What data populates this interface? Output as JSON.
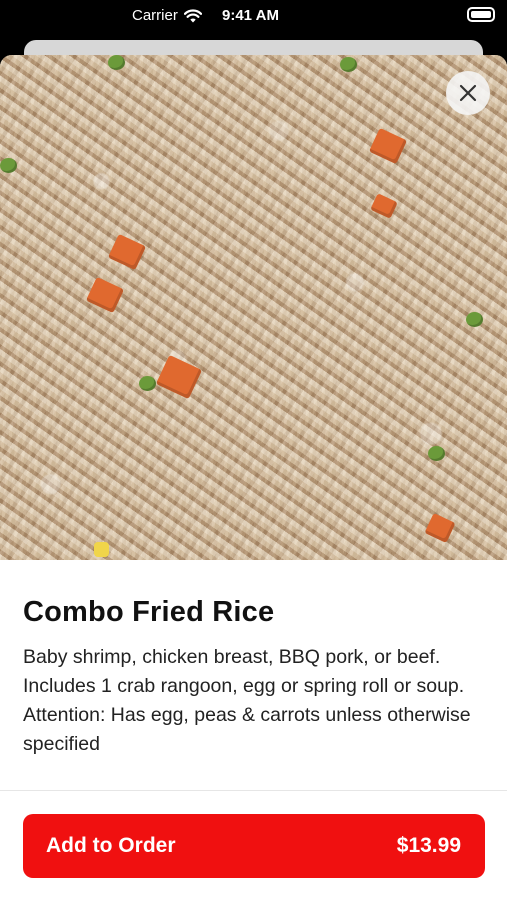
{
  "status_bar": {
    "carrier": "Carrier",
    "time": "9:41 AM",
    "wifi_icon": "wifi-icon",
    "battery_icon": "battery-icon"
  },
  "item": {
    "image_icon": "fried-rice-photo",
    "title": "Combo Fried Rice",
    "description": "Baby shrimp, chicken breast, BBQ pork, or beef. Includes 1 crab rangoon, egg or spring roll or soup. Attention: Has egg, peas & carrots unless otherwise specified"
  },
  "close_icon": "close-icon",
  "order_button": {
    "label": "Add to Order",
    "price": "$13.99"
  },
  "colors": {
    "accent": "#f01010",
    "status_bar_bg": "#000000",
    "sheet_bg": "#ffffff"
  }
}
